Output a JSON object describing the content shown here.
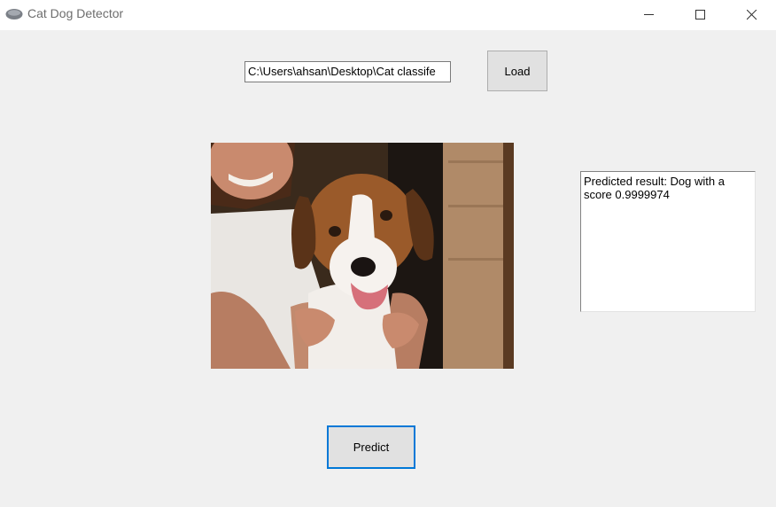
{
  "window": {
    "title": "Cat Dog Detector",
    "icon": "gray-oval-app-icon",
    "controls": [
      "minimize-icon",
      "maximize-icon",
      "close-icon"
    ]
  },
  "file_path": {
    "value": "C:\\Users\\ahsan\\Desktop\\Cat classife"
  },
  "buttons": {
    "load": "Load",
    "predict": "Predict"
  },
  "image": {
    "subject": "photo"
  },
  "result": {
    "text": "Predicted result: Dog with a\nscore 0.9999974"
  },
  "colors": {
    "window_bg": "#f0f0f0",
    "focus_border": "#0078d7"
  }
}
